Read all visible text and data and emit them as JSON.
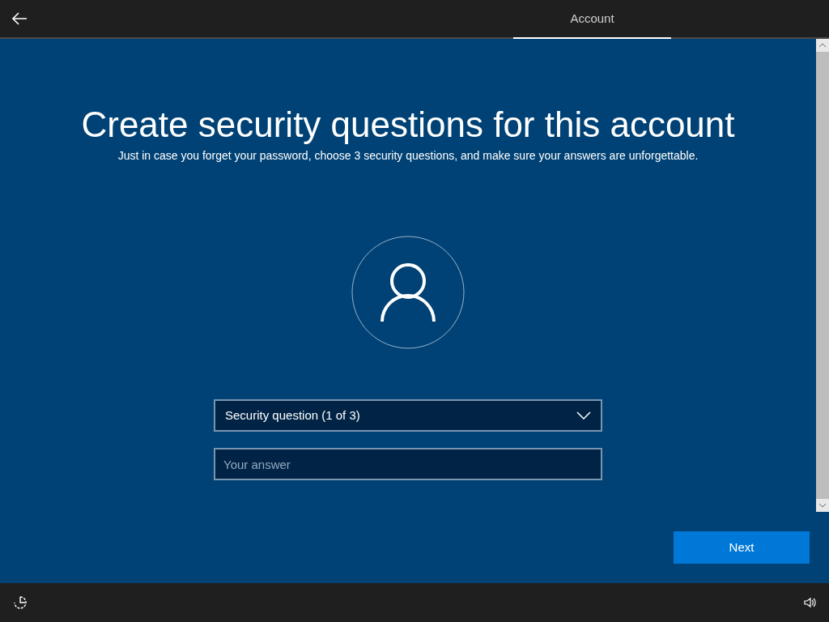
{
  "tabs": [
    {
      "label": "Account",
      "selected": true
    }
  ],
  "heading": "Create security questions for this account",
  "subheading": "Just in case you forget your password, choose 3 security questions, and make sure your answers are unforgettable.",
  "question_dropdown": {
    "value": "Security question (1 of 3)"
  },
  "answer_field": {
    "placeholder": "Your answer"
  },
  "buttons": [
    {
      "label": "Next"
    }
  ]
}
